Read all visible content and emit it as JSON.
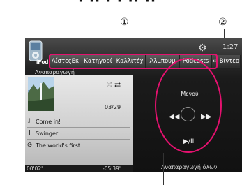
{
  "heading_partial": "· ·· · · ·· ··",
  "callouts": {
    "one": "①",
    "two": "②"
  },
  "header": {
    "device_label": "iPod",
    "clock": "1:27",
    "tabs": [
      {
        "label": "ΛίστεςΕκ"
      },
      {
        "label": "Κατηγορί"
      },
      {
        "label": "Καλλιτέχ"
      },
      {
        "label": "Άλμπουμ"
      },
      {
        "label": "Podcasts"
      },
      {
        "label": "↔ Βίντεο"
      }
    ]
  },
  "left_panel": {
    "playback_label": "Αναπαραγωγή",
    "track_count": "03/29",
    "song": "Come in!",
    "artist": "Swinger",
    "album": "The world's first",
    "time_elapsed": "00'02\"",
    "time_remaining": "-05'39\""
  },
  "controls": {
    "menu_label": "Μενού",
    "play_pause": "▶/II",
    "play_all_label": "Αναπαραγωγή όλων"
  },
  "colors": {
    "highlight": "#e5116f"
  }
}
